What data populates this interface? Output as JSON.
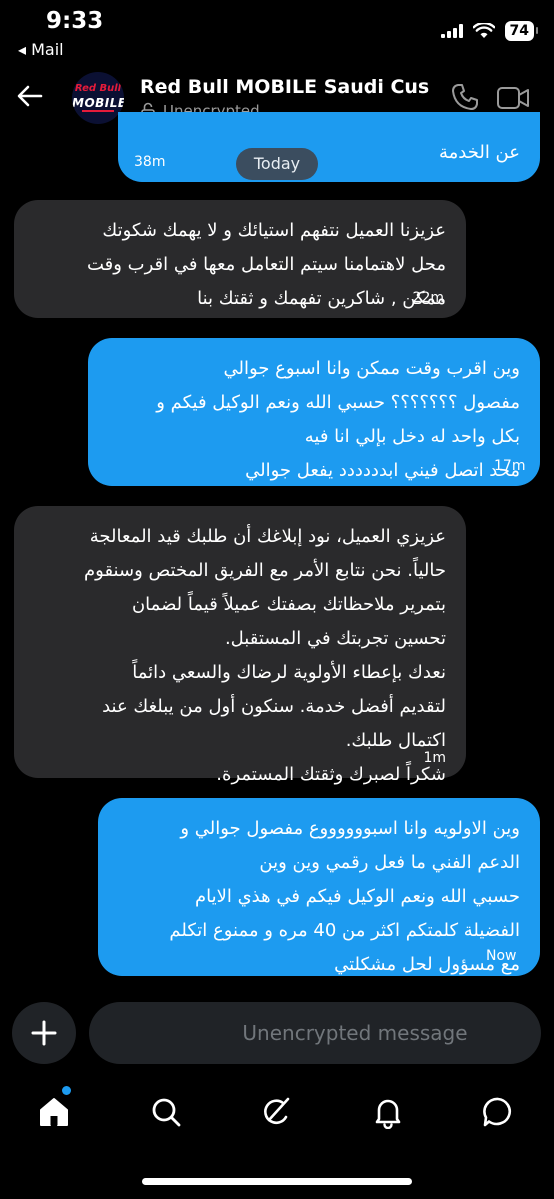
{
  "status": {
    "time": "9:33",
    "back_app": "◂ Mail",
    "battery": "74"
  },
  "header": {
    "contact_name": "Red Bull MOBILE Saudi Cus...",
    "encryption_status": "Unencrypted",
    "avatar": {
      "logo_line1": "Red Bull",
      "logo_line2": "MOBILE"
    }
  },
  "messages": [
    {
      "direction": "out",
      "text": "عن الخدمة",
      "time": "38m"
    },
    {
      "direction": "in",
      "text": "عزيزنا العميل نتفهم استيائك و لا يهمك شكوتك\nمحل لاهتمامنا سيتم التعامل معها في اقرب وقت\nممكن , شاكرين تفهمك و ثقتك بنا",
      "time": "22m"
    },
    {
      "direction": "out",
      "text": "وين اقرب وقت ممكن وانا اسبوع جوالي\nمفصول ؟؟؟؟؟؟؟ حسبي الله ونعم الوكيل فيكم و\nبكل واحد له دخل بإلي انا فيه\nمحد اتصل فيني ابدددددد يفعل جوالي",
      "time": "17m"
    },
    {
      "direction": "in",
      "text": "عزيزي العميل، نود إبلاغك أن طلبك قيد المعالجة\nحالياً. نحن نتابع الأمر مع الفريق المختص وسنقوم\nبتمرير ملاحظاتك بصفتك عميلاً قيماً لضمان\nتحسين تجربتك في المستقبل.\nنعدك بإعطاء الأولوية لرضاك والسعي دائماً\nلتقديم أفضل خدمة. سنكون أول من يبلغك عند\nاكتمال طلبك.\nشكراً لصبرك وثقتك المستمرة.",
      "time": "1m"
    },
    {
      "direction": "out",
      "text": "وين الاولويه وانا اسبووووووع مفصول جوالي و\nالدعم الفني ما فعل رقمي وين وين\nحسبي الله ونعم الوكيل فيكم في هذي الايام\nالفضيلة كلمتكم اكثر من 40 مره و ممنوع اتكلم\nمع مسؤول لحل مشكلتي",
      "time": "Now"
    }
  ],
  "date_separator": "Today",
  "composer": {
    "placeholder": "Unencrypted message"
  },
  "nav": {
    "items": [
      "home-icon",
      "search-icon",
      "grok-icon",
      "notifications-icon",
      "messages-icon"
    ],
    "home_has_notification": true
  },
  "colors": {
    "accent": "#1d9bf0",
    "incoming": "#2a2a2c",
    "background": "#000000"
  }
}
